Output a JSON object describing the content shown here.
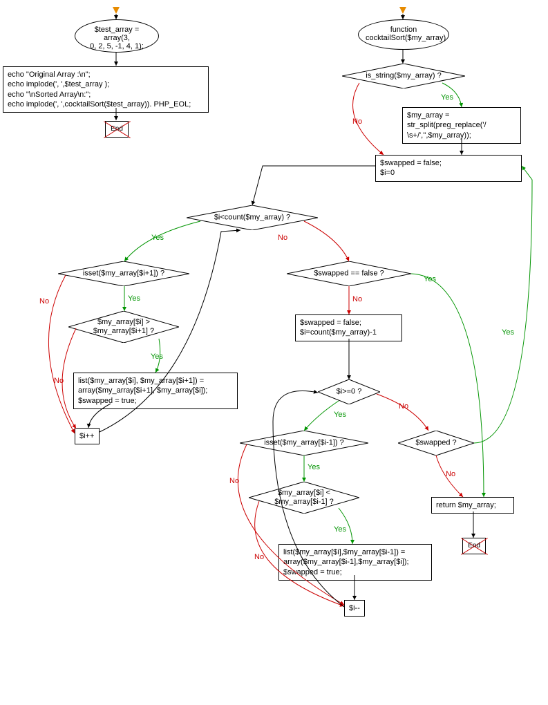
{
  "left": {
    "start": "$test_array = array(3,\n0, 2, 5, -1, 4, 1);",
    "echo": "echo \"Original Array :\\n\";\necho implode(', ',$test_array );\necho \"\\nSorted Array\\n:\";\necho implode(', ',cocktailSort($test_array)). PHP_EOL;",
    "end": "End"
  },
  "right": {
    "func": "function\ncocktailSort($my_array)",
    "is_string": "is_string($my_array) ?",
    "str_split": "$my_array =\nstr_split(preg_replace('/\n\\s+/','',$my_array));",
    "init": "$swapped = false;\n$i=0",
    "loop1_cond": "$i<count($my_array) ?",
    "isset_next": "isset($my_array[$i+1]) ?",
    "cmp_next": "$my_array[$i] >\n$my_array[$i+1] ?",
    "swap_next": "list($my_array[$i], $my_array[$i+1]) =\narray($my_array[$i+1], $my_array[$i]);\n$swapped = true;",
    "inc": "$i++",
    "swapped_false": "$swapped == false ?",
    "reset": "$swapped = false;\n$i=count($my_array)-1",
    "loop2_cond": "$i>=0 ?",
    "isset_prev": "isset($my_array[$i-1]) ?",
    "cmp_prev": "$my_array[$i] <\n$my_array[$i-1] ?",
    "swap_prev": "list($my_array[$i],$my_array[$i-1]) =\narray($my_array[$i-1],$my_array[$i]);\n$swapped = true;",
    "dec": "$i--",
    "swapped2": "$swapped ?",
    "return": "return $my_array;",
    "end": "End"
  },
  "labels": {
    "yes": "Yes",
    "no": "No"
  }
}
